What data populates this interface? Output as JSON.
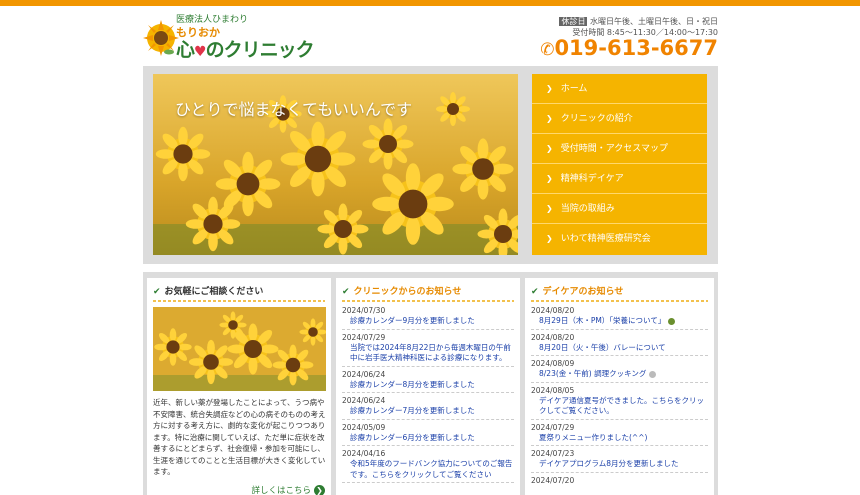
{
  "header": {
    "org": "医療法人ひまわり",
    "logo_sub": "もりおか",
    "logo_main_a": "心",
    "logo_main_b": "のクリニック",
    "closed_badge": "休診日",
    "closed_text": "水曜日午後、土曜日午後、日・祝日",
    "hours_text": "受付時間  8:45～11:30／14:00～17:30",
    "phone": "019-613-6677"
  },
  "hero": {
    "tagline": "ひとりで悩まなくてもいいんです"
  },
  "nav": {
    "items": [
      {
        "label": "ホーム"
      },
      {
        "label": "クリニックの紹介"
      },
      {
        "label": "受付時間・アクセスマップ"
      },
      {
        "label": "精神科デイケア"
      },
      {
        "label": "当院の取組み"
      },
      {
        "label": "いわて精神医療研究会"
      }
    ]
  },
  "consult": {
    "title": "お気軽にご相談ください",
    "body": "近年、新しい薬が登場したことによって、うつ病や不安障害、統合失調症などの心の病そのものの考え方に対する考え方に、劇的な変化が起こりつつあります。特に治療に関していえば、ただ単に症状を改善するにとどまらず、社会復帰・参加を可能にし、生涯を通じてのことと生活目標が大きく変化しています。",
    "more": "詳しくはこちら"
  },
  "clinic_news": {
    "title": "クリニックからのお知らせ",
    "items": [
      {
        "date": "2024/07/30",
        "title": "診療カレンダー9月分を更新しました"
      },
      {
        "date": "2024/07/29",
        "title": "当院では2024年8月22日から毎週木曜日の午前中に岩手医大精神科医による診療になります。"
      },
      {
        "date": "2024/06/24",
        "title": "診療カレンダー8月分を更新しました"
      },
      {
        "date": "2024/06/24",
        "title": "診療カレンダー7月分を更新しました"
      },
      {
        "date": "2024/05/09",
        "title": "診療カレンダー6月分を更新しました"
      },
      {
        "date": "2024/04/16",
        "title": "令和5年度のフードバンク協力についてのご報告です。こちらをクリックしてご覧ください"
      }
    ]
  },
  "daycare_news": {
    "title": "デイケアのお知らせ",
    "items": [
      {
        "date": "2024/08/20",
        "title": "8月29日（木・PM）「栄養について」"
      },
      {
        "date": "2024/08/20",
        "title": "8月20日（火・午後）バレーについて"
      },
      {
        "date": "2024/08/09",
        "title": "8/23(金・午前) 調理クッキング"
      },
      {
        "date": "2024/08/05",
        "title": "デイケア通信夏号ができました。こちらをクリックしてご覧ください。"
      },
      {
        "date": "2024/07/29",
        "title": "夏祭りメニュー作りました(^^)"
      },
      {
        "date": "2024/07/23",
        "title": "デイケアプログラム8月分を更新しました"
      },
      {
        "date": "2024/07/20",
        "title": ""
      }
    ]
  },
  "colors": {
    "accent": "#f29600",
    "nav_bg": "#f5b400",
    "green": "#2e7d32",
    "link": "#1a3fa8"
  }
}
